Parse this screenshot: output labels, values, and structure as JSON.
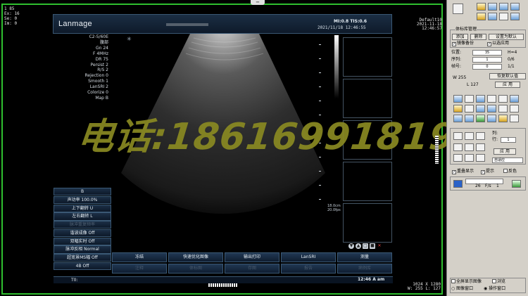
{
  "top_handle": "−",
  "corner_tl": [
    "1  85",
    "Ex:  16",
    "Se:  0",
    "Im:  0"
  ],
  "corner_tr": [
    "Default10",
    "2021-11-18",
    "12:46:57"
  ],
  "corner_br": [
    "1024 X 1280",
    "W:  255    L:  127"
  ],
  "header": {
    "brand": "Lanmage",
    "mi_ti": "MI:0.8  TIS:0.6",
    "date": "2021/11/18 12:46:55"
  },
  "params": [
    "C2-5/60E",
    "腹部",
    "Gn 24",
    "F 4MHz",
    "DR 75",
    "Persist 2",
    "R/S 2",
    "Rejection 0",
    "Smooth 1",
    "LanSRI 2",
    "Colorize 0",
    "Map B"
  ],
  "depth": [
    "18.0cm",
    "20.0fps"
  ],
  "controls": [
    {
      "label": "B",
      "dim": false
    },
    {
      "label": "声功率 100.0%",
      "dim": false
    },
    {
      "label": "上下翻转  U",
      "dim": false
    },
    {
      "label": "左右翻转  L",
      "dim": false
    },
    {
      "label": "脉冲重复频率",
      "dim": true
    },
    {
      "label": "谐波成像  Off",
      "dim": false
    },
    {
      "label": "双幅实时  Off",
      "dim": false
    },
    {
      "label": "脉冲反相  Normal",
      "dim": false
    },
    {
      "label": "超宽景MS幅  Off",
      "dim": false
    },
    {
      "label": "4B  Off",
      "dim": false
    }
  ],
  "soft_buttons": [
    {
      "label": "冻结",
      "dim": false
    },
    {
      "label": "快速优化图像",
      "dim": false
    },
    {
      "label": "输出打印",
      "dim": false
    },
    {
      "label": "LanSRI",
      "dim": false
    },
    {
      "label": "测量",
      "dim": false
    },
    {
      "label": "注释",
      "dim": true
    },
    {
      "label": "体标图",
      "dim": true
    },
    {
      "label": "存图",
      "dim": true
    },
    {
      "label": "报告",
      "dim": true
    },
    {
      "label": "病例库",
      "dim": true
    }
  ],
  "t0": "T0:",
  "t0_time": "12:46  A  am",
  "watermark": "电话:18616991819",
  "right_panel": {
    "group_title": "体标库管理",
    "btn_add": "添加",
    "btn_del": "删除",
    "btn_set_default": "设置为默认",
    "chk_mirror": "镜像备份",
    "chk_apply": "以选应用",
    "lbl_pos": "位置:",
    "pos_val": "35",
    "pos_r": "H=4",
    "lbl_seq": "序列:",
    "seq_val": "1",
    "seq_r": "0/6",
    "lbl_frame": "帧号:",
    "frame_val": "0",
    "frame_r": "1/1",
    "w_val": "W 255",
    "l_val": "L 127",
    "btn_restore": "恢复默认值",
    "btn_apply": "应 用",
    "lbl_col": "列:",
    "lbl_row": "行:",
    "col_val": "1",
    "row_val": "1",
    "btn_apply2": "应 用",
    "adaptive": "自适应",
    "chk_overlay": "重叠显示",
    "chk_tip": "提示",
    "chk_invert": "反色",
    "play_frame": "26",
    "play_fps": "F/s",
    "play_1": "1",
    "chk_fullscreen": "全屏显示图像",
    "chk_browse": "浏览",
    "radio_a": "图像窗口",
    "radio_b": "操作窗口"
  }
}
